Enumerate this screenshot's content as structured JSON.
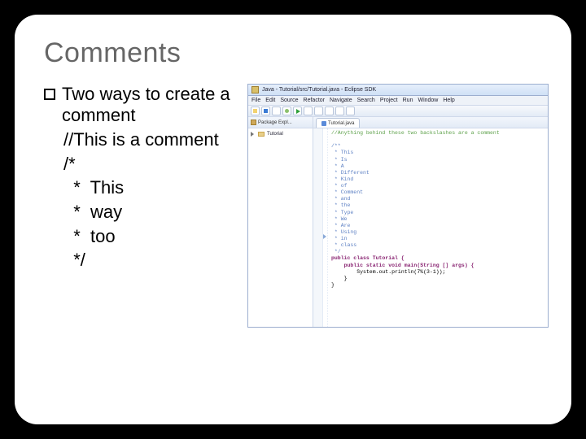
{
  "slide": {
    "title": "Comments",
    "bullet": "Two ways to create a comment",
    "sub": "//This is a comment\n/*\n  *  This\n  *  way\n  *  too\n  */"
  },
  "ide": {
    "window_title": "Java - Tutorial/src/Tutorial.java - Eclipse SDK",
    "menus": [
      "File",
      "Edit",
      "Source",
      "Refactor",
      "Navigate",
      "Search",
      "Project",
      "Run",
      "Window",
      "Help"
    ],
    "package_explorer_label": "Package Expl...",
    "package_root": "Tutorial",
    "editor_tab": "Tutorial.java",
    "code": {
      "line_comment": "//Anything behind these two backslashes are a comment",
      "block": [
        "/**",
        " * This",
        " * Is",
        " * A",
        " * Different",
        " * Kind",
        " * of",
        " * Comment",
        " * and",
        " * the",
        " * Type",
        " * We",
        " * Are",
        " * Using",
        " * in",
        " * class",
        " */"
      ],
      "class_decl": "public class Tutorial {",
      "main_decl": "    public static void main(String [] args) {",
      "print": "        System.out.println(7%(3-1));",
      "close1": "    }",
      "close2": "}"
    }
  }
}
